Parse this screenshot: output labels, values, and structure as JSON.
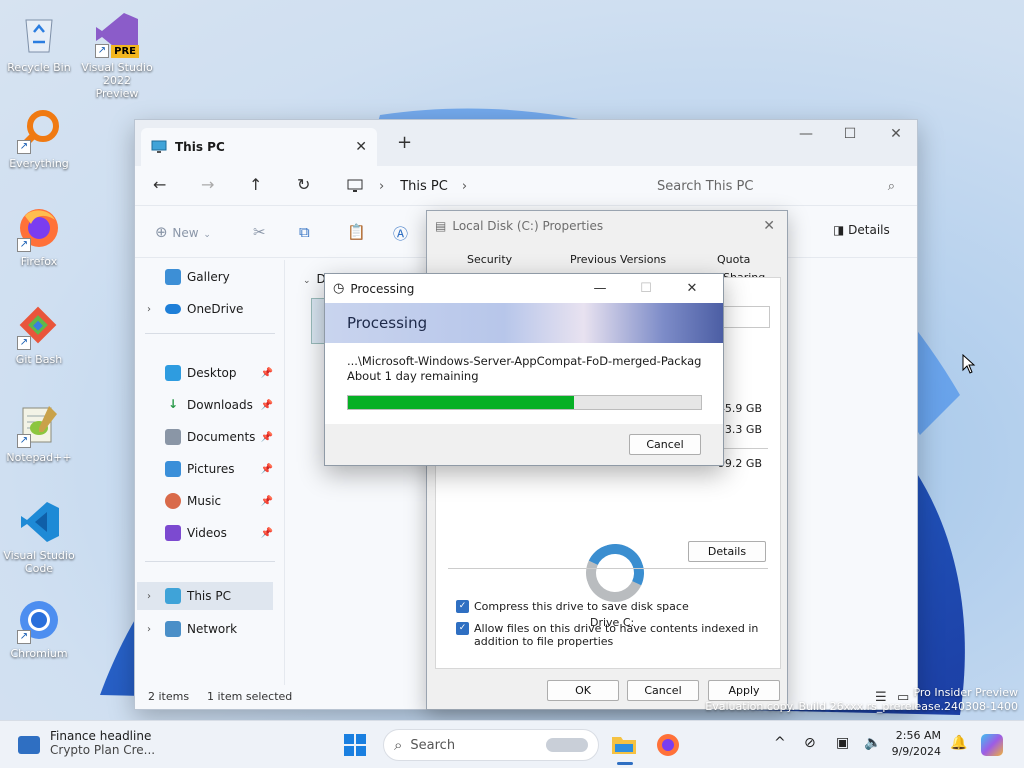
{
  "desktop": {
    "icons": [
      {
        "label": "Recycle Bin",
        "icon": "recycle-bin-icon"
      },
      {
        "label": "Visual Studio 2022 Preview",
        "icon": "visual-studio-preview-icon",
        "badge": "PRE"
      },
      {
        "label": "Everything",
        "icon": "everything-search-icon"
      },
      {
        "label": "Firefox",
        "icon": "firefox-icon"
      },
      {
        "label": "Git Bash",
        "icon": "git-bash-icon"
      },
      {
        "label": "Notepad++",
        "icon": "notepad-plus-plus-icon"
      },
      {
        "label": "Visual Studio Code",
        "icon": "vscode-icon"
      },
      {
        "label": "Chromium",
        "icon": "chromium-icon"
      }
    ],
    "watermark": {
      "line1": "Pro Insider Preview",
      "line2": "Evaluation copy. Build 26xxx.rs_prerelease.240308-1400"
    }
  },
  "explorer": {
    "tab_title": "This PC",
    "address": "This PC",
    "search_placeholder": "Search This PC",
    "toolbar": {
      "new_label": "New",
      "details_label": "Details"
    },
    "sidebar": {
      "items": [
        {
          "label": "Gallery",
          "pinned": false
        },
        {
          "label": "OneDrive",
          "pinned": false
        },
        {
          "label": "Desktop",
          "pinned": true
        },
        {
          "label": "Downloads",
          "pinned": true
        },
        {
          "label": "Documents",
          "pinned": true
        },
        {
          "label": "Pictures",
          "pinned": true
        },
        {
          "label": "Music",
          "pinned": true
        },
        {
          "label": "Videos",
          "pinned": true
        },
        {
          "label": "This PC",
          "selected": true
        },
        {
          "label": "Network"
        }
      ]
    },
    "content_letter": "D",
    "status": {
      "items": "2 items",
      "selected": "1 item selected"
    }
  },
  "properties": {
    "title": "Local Disk (C:) Properties",
    "tabs": [
      "Security",
      "Previous Versions",
      "Quota",
      "Sharing"
    ],
    "sizes": [
      "45.9 GB",
      "53.3 GB",
      "99.2 GB"
    ],
    "drive_label": "Drive C:",
    "details_button": "Details",
    "compress_label": "Compress this drive to save disk space",
    "index_label": "Allow files on this drive to have contents indexed in addition to file properties",
    "ok": "OK",
    "cancel": "Cancel",
    "apply": "Apply",
    "used_fraction": 0.46
  },
  "processing": {
    "title": "Processing",
    "banner": "Processing",
    "path": "...\\Microsoft-Windows-Server-AppCompat-FoD-merged-Package~",
    "remaining": "About 1 day remaining",
    "progress": 0.64,
    "cancel": "Cancel"
  },
  "taskbar": {
    "widget_title": "Finance headline",
    "widget_subtitle": "Crypto Plan Cre...",
    "search_placeholder": "Search",
    "time": "2:56 AM",
    "date": "9/9/2024"
  },
  "colors": {
    "progress": "#06b025",
    "accent": "#2f6fc2",
    "drive_used": "#3b8ed0"
  }
}
